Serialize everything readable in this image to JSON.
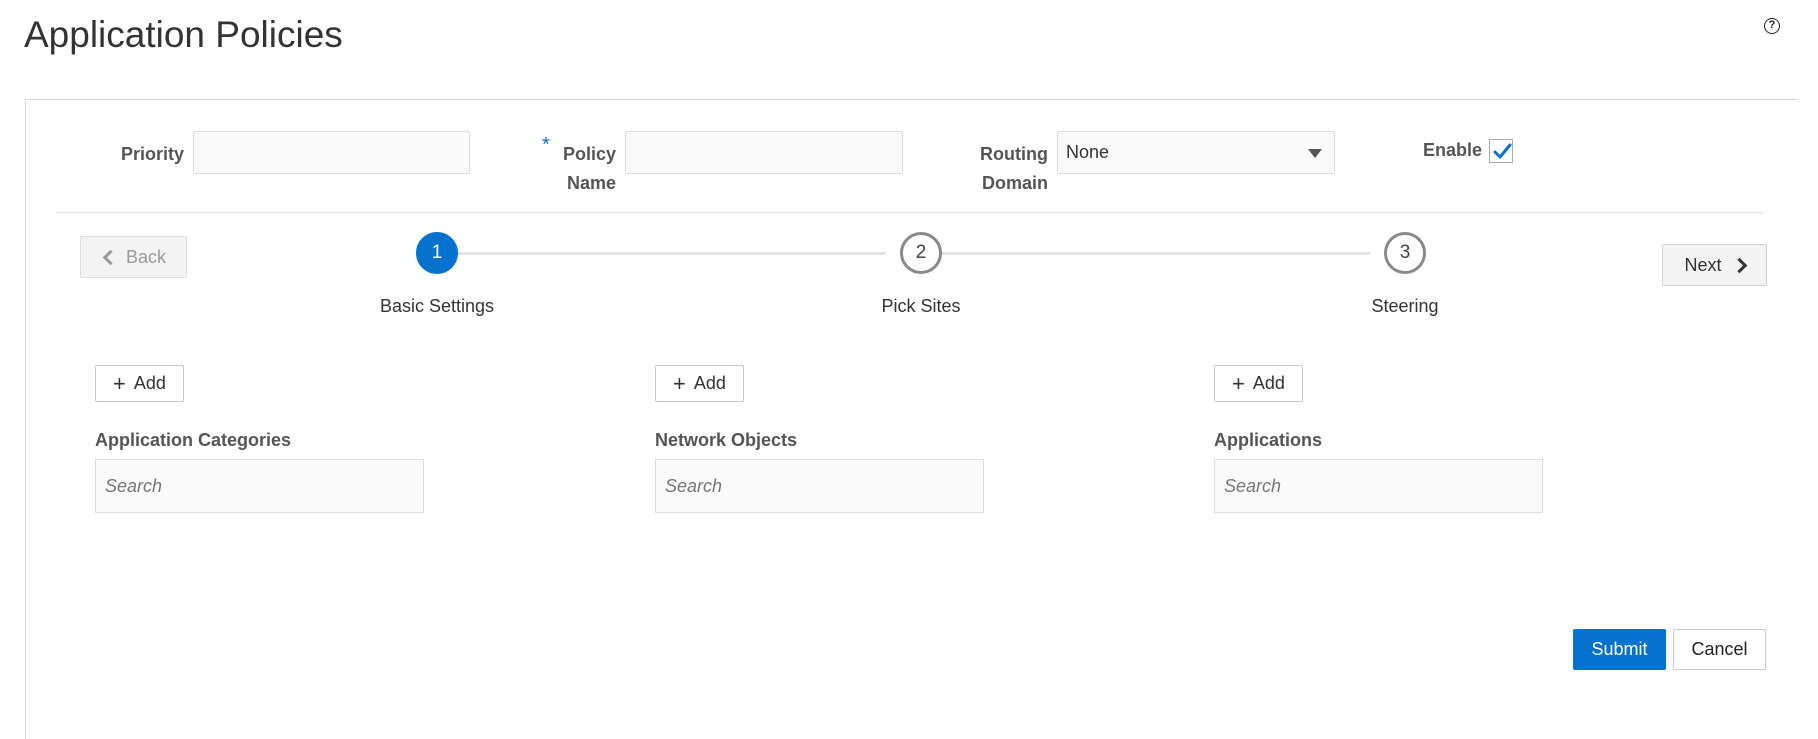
{
  "header": {
    "title": "Application Policies",
    "help_icon": "help-circle-icon"
  },
  "form": {
    "priority_label": "Priority",
    "priority_value": "",
    "policy_name_required_marker": "*",
    "policy_name_label_line1": "Policy",
    "policy_name_label_line2": "Name",
    "policy_name_value": "",
    "routing_domain_label_line1": "Routing",
    "routing_domain_label_line2": "Domain",
    "routing_domain_value": "None",
    "enable_label": "Enable",
    "enable_checked": true
  },
  "wizard": {
    "back_label": "Back",
    "next_label": "Next",
    "steps": [
      {
        "number": "1",
        "label": "Basic Settings",
        "active": true
      },
      {
        "number": "2",
        "label": "Pick Sites",
        "active": false
      },
      {
        "number": "3",
        "label": "Steering",
        "active": false
      }
    ]
  },
  "sections": [
    {
      "add_label": "Add",
      "title": "Application Categories",
      "search_placeholder": "Search"
    },
    {
      "add_label": "Add",
      "title": "Network Objects",
      "search_placeholder": "Search"
    },
    {
      "add_label": "Add",
      "title": "Applications",
      "search_placeholder": "Search"
    }
  ],
  "footer": {
    "submit_label": "Submit",
    "cancel_label": "Cancel"
  },
  "colors": {
    "accent": "#0572ce",
    "check": "#0572ce"
  }
}
